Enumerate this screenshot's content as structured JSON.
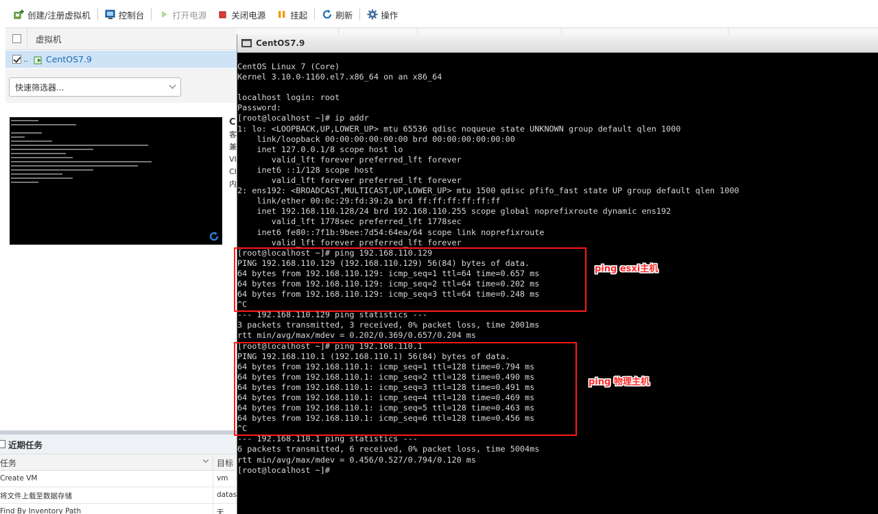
{
  "toolbar": {
    "create_label": "创建/注册虚拟机",
    "console_label": "控制台",
    "power_on_label": "打开电源",
    "power_off_label": "关闭电源",
    "suspend_label": "挂起",
    "refresh_label": "刷新",
    "actions_label": "操作"
  },
  "vm_list": {
    "column_header": "虚拟机",
    "rows": [
      {
        "ellipsis": "..",
        "name": "CentOS7.9"
      }
    ],
    "filter_placeholder": "快速筛选器..."
  },
  "details": {
    "title_fragment": "C",
    "label_fragments": [
      "客",
      "兼",
      "VI",
      "CI",
      "内"
    ]
  },
  "recent_tasks": {
    "title": "近期任务",
    "columns": [
      "任务",
      "目标"
    ],
    "rows": [
      {
        "task": "Create VM",
        "target": "vm"
      },
      {
        "task": "将文件上载至数据存储",
        "target": "datastore"
      },
      {
        "task": "Find By Inventory Path",
        "target": "无"
      }
    ]
  },
  "console": {
    "title": "CentOS7.9",
    "lines": [
      "CentOS Linux 7 (Core)",
      "Kernel 3.10.0-1160.el7.x86_64 on an x86_64",
      "",
      "localhost login: root",
      "Password:",
      "[root@localhost ~]# ip addr",
      "1: lo: <LOOPBACK,UP,LOWER_UP> mtu 65536 qdisc noqueue state UNKNOWN group default qlen 1000",
      "    link/loopback 00:00:00:00:00:00 brd 00:00:00:00:00:00",
      "    inet 127.0.0.1/8 scope host lo",
      "       valid_lft forever preferred_lft forever",
      "    inet6 ::1/128 scope host",
      "       valid_lft forever preferred_lft forever",
      "2: ens192: <BROADCAST,MULTICAST,UP,LOWER_UP> mtu 1500 qdisc pfifo_fast state UP group default qlen 1000",
      "    link/ether 00:0c:29:fd:39:2a brd ff:ff:ff:ff:ff:ff",
      "    inet 192.168.110.128/24 brd 192.168.110.255 scope global noprefixroute dynamic ens192",
      "       valid_lft 1778sec preferred_lft 1778sec",
      "    inet6 fe80::7f1b:9bee:7d54:64ea/64 scope link noprefixroute",
      "       valid_lft forever preferred_lft forever",
      "[root@localhost ~]# ping 192.168.110.129",
      "PING 192.168.110.129 (192.168.110.129) 56(84) bytes of data.",
      "64 bytes from 192.168.110.129: icmp_seq=1 ttl=64 time=0.657 ms",
      "64 bytes from 192.168.110.129: icmp_seq=2 ttl=64 time=0.202 ms",
      "64 bytes from 192.168.110.129: icmp_seq=3 ttl=64 time=0.248 ms",
      "^C",
      "--- 192.168.110.129 ping statistics ---",
      "3 packets transmitted, 3 received, 0% packet loss, time 2001ms",
      "rtt min/avg/max/mdev = 0.202/0.369/0.657/0.204 ms",
      "[root@localhost ~]# ping 192.168.110.1",
      "PING 192.168.110.1 (192.168.110.1) 56(84) bytes of data.",
      "64 bytes from 192.168.110.1: icmp_seq=1 ttl=128 time=0.794 ms",
      "64 bytes from 192.168.110.1: icmp_seq=2 ttl=128 time=0.490 ms",
      "64 bytes from 192.168.110.1: icmp_seq=3 ttl=128 time=0.491 ms",
      "64 bytes from 192.168.110.1: icmp_seq=4 ttl=128 time=0.469 ms",
      "64 bytes from 192.168.110.1: icmp_seq=5 ttl=128 time=0.463 ms",
      "64 bytes from 192.168.110.1: icmp_seq=6 ttl=128 time=0.456 ms",
      "^C",
      "--- 192.168.110.1 ping statistics ---",
      "6 packets transmitted, 6 received, 0% packet loss, time 5004ms",
      "rtt min/avg/max/mdev = 0.456/0.527/0.794/0.120 ms",
      "[root@localhost ~]#"
    ]
  },
  "annotations": {
    "esxi_label": "ping esxi主机",
    "physical_label": "ping 物理主机"
  },
  "colors": {
    "highlight_box": "#ff1a1a",
    "link_blue": "#1a6bb0",
    "selected_row": "#cfe3f7"
  }
}
